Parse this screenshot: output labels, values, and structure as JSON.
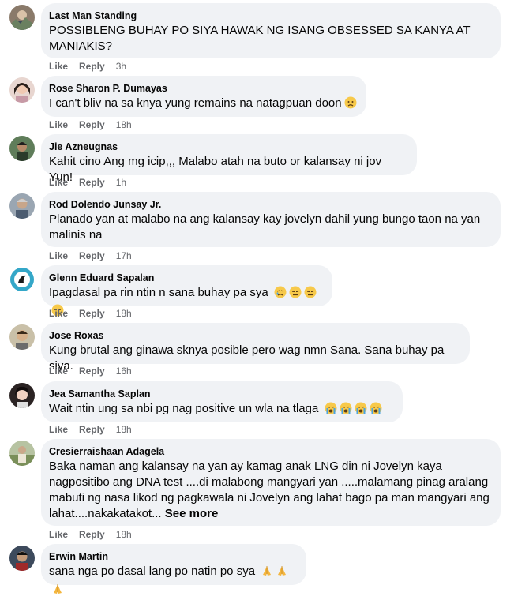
{
  "actions": {
    "like": "Like",
    "reply": "Reply"
  },
  "comments": [
    {
      "author": "Last Man Standing",
      "text": "POSSIBLENG BUHAY PO SIYA HAWAK NG ISANG OBSESSED SA KANYA AT MANIAKIS?",
      "time": "3h"
    },
    {
      "author": "Rose Sharon P. Dumayas",
      "text": "I can't bliv na sa knya yung remains na natagpuan doon",
      "time": "18h"
    },
    {
      "author": "Jie Azneugnas",
      "text": "Kahit cino Ang mg icip,,, Malabo atah na buto or kalansay ni jov Yun!",
      "time": "1h"
    },
    {
      "author": "Rod Dolendo Junsay Jr.",
      "text": "Planado yan at malabo na ang kalansay kay jovelyn dahil yung bungo taon na yan malinis na",
      "time": "17h"
    },
    {
      "author": "Glenn Eduard Sapalan",
      "text": "Ipagdasal pa rin ntin n sana buhay pa sya",
      "time": "18h"
    },
    {
      "author": "Jose Roxas",
      "text": "Kung brutal ang ginawa sknya posible pero wag nmn Sana. Sana buhay pa siya.",
      "time": "16h"
    },
    {
      "author": "Jea Samantha Saplan",
      "text": "Wait ntin ung sa nbi pg nag positive un wla na tlaga",
      "time": "18h"
    },
    {
      "author": "Cresierraishaan Adagela",
      "text": "Baka naman ang kalansay na yan ay kamag anak LNG din ni Jovelyn kaya nagpositibo ang DNA test ....di malabong mangyari yan .....malamang pinag aralang mabuti ng nasa likod ng pagkawala ni Jovelyn ang lahat bago pa man mangyari ang lahat....nakakatakot... ",
      "see_more": "See more",
      "time": "18h"
    },
    {
      "author": "Erwin Martin",
      "text": "sana nga po dasal lang po natin po sya",
      "time": ""
    }
  ]
}
